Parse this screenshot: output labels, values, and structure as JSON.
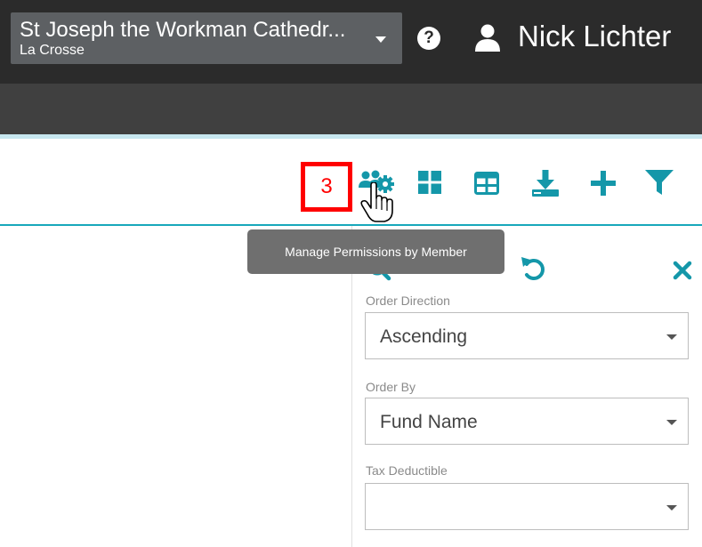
{
  "header": {
    "org_name": "St Joseph the Workman Cathedr...",
    "org_location": "La Crosse",
    "user_name": "Nick Lichter",
    "help_glyph": "?"
  },
  "toolbar": {
    "step_number": "3",
    "tooltip": "Manage Permissions by Member",
    "icons": [
      "manage-permissions-icon",
      "grid-view-icon",
      "table-view-icon",
      "download-icon",
      "add-icon",
      "filter-icon"
    ],
    "accent_color": "#1497a9"
  },
  "filter_panel": {
    "fields": [
      {
        "label": "Order Direction",
        "value": "Ascending"
      },
      {
        "label": "Order By",
        "value": "Fund Name"
      },
      {
        "label": "Tax Deductible",
        "value": ""
      }
    ]
  }
}
